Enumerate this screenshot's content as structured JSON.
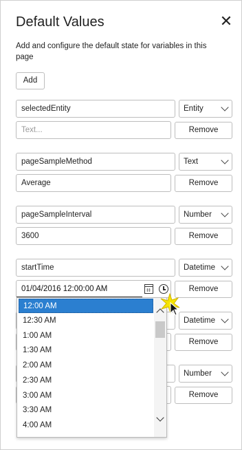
{
  "panel": {
    "title": "Default Values",
    "close_glyph": "✕",
    "description": "Add and configure the default state for variables in this page",
    "add_label": "Add"
  },
  "variables": [
    {
      "name": "selectedEntity",
      "type": "Entity",
      "value": "",
      "value_placeholder": "Text...",
      "remove_label": "Remove"
    },
    {
      "name": "pageSampleMethod",
      "type": "Text",
      "value": "Average",
      "remove_label": "Remove"
    },
    {
      "name": "pageSampleInterval",
      "type": "Number",
      "value": "3600",
      "remove_label": "Remove"
    },
    {
      "name": "startTime",
      "type": "Datetime",
      "value": "01/04/2016 12:00:00 AM",
      "remove_label": "Remove"
    },
    {
      "name": "",
      "type": "Datetime",
      "value": "",
      "remove_label": "Remove"
    },
    {
      "name": "",
      "type": "Number",
      "value": "",
      "remove_label": "Remove"
    }
  ],
  "time_dropdown": {
    "selected": "12:00 AM",
    "options": [
      "12:00 AM",
      "12:30 AM",
      "1:00 AM",
      "1:30 AM",
      "2:00 AM",
      "2:30 AM",
      "3:00 AM",
      "3:30 AM",
      "4:00 AM"
    ]
  },
  "icons": {
    "close": "close-icon",
    "calendar": "calendar-icon",
    "clock": "clock-icon",
    "chevron": "chevron-down-icon"
  },
  "colors": {
    "selected_option": "#2b7fd0",
    "border": "#bdbdbd",
    "cursor_highlight": "#f5e400"
  }
}
